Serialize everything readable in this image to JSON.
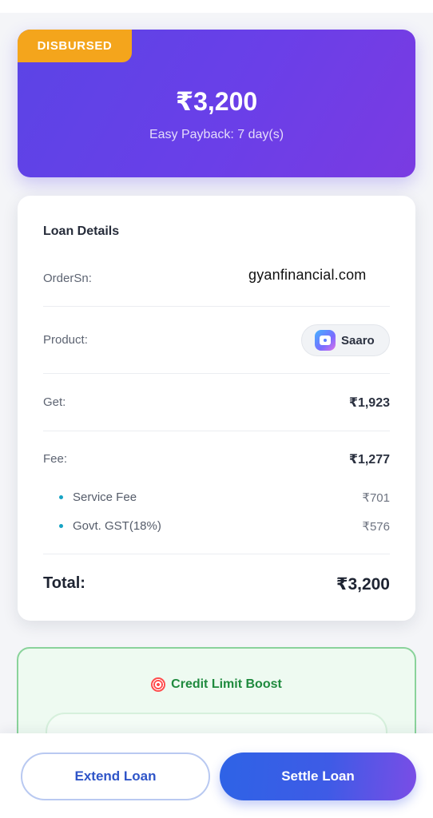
{
  "hero": {
    "status_badge": "DISBURSED",
    "amount": "₹3,200",
    "payback_text": "Easy Payback: 7 day(s)"
  },
  "loan_details": {
    "title": "Loan Details",
    "order_label": "OrderSn:",
    "order_value": "gyanfinancial.com",
    "product_label": "Product:",
    "product_name": "Saaro",
    "get_label": "Get:",
    "get_value": "₹1,923",
    "fee_label": "Fee:",
    "fee_value": "₹1,277",
    "fee_breakdown": [
      {
        "label": "Service Fee",
        "value": "₹701"
      },
      {
        "label": "Govt. GST(18%)",
        "value": "₹576"
      }
    ],
    "total_label": "Total:",
    "total_value": "₹3,200"
  },
  "credit_boost": {
    "title": "Credit Limit Boost",
    "icon": "target-icon"
  },
  "actions": {
    "extend_label": "Extend Loan",
    "settle_label": "Settle Loan"
  },
  "colors": {
    "hero_gradient_start": "#5b44e6",
    "hero_gradient_end": "#7a3be2",
    "badge": "#f4a51c",
    "boost_green": "#1f8a3e",
    "primary_blue": "#2f55c8"
  }
}
